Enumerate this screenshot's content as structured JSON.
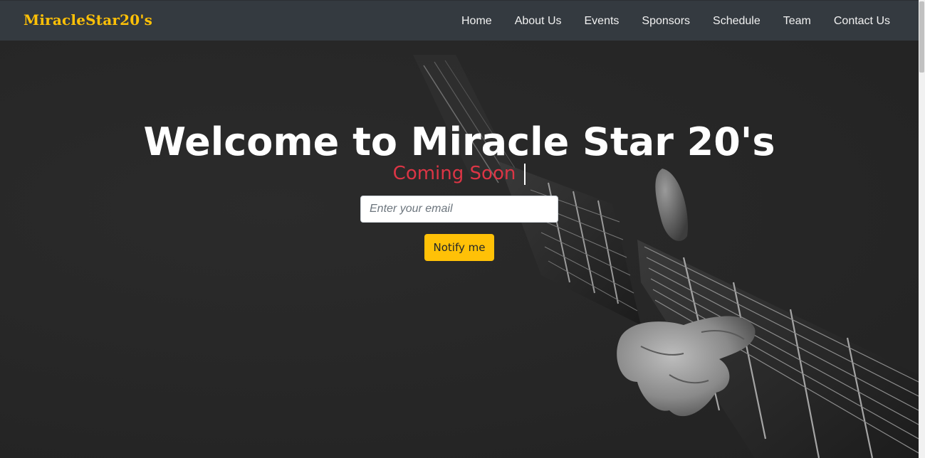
{
  "navbar": {
    "brand": "MiracleStar20's",
    "links": [
      {
        "label": "Home"
      },
      {
        "label": "About Us"
      },
      {
        "label": "Events"
      },
      {
        "label": "Sponsors"
      },
      {
        "label": "Schedule"
      },
      {
        "label": "Team"
      },
      {
        "label": "Contact Us"
      }
    ]
  },
  "hero": {
    "title": "Welcome to Miracle Star 20's",
    "subtitle": "Coming Soon",
    "email_placeholder": "Enter your email",
    "email_value": "",
    "notify_label": "Notify me",
    "background_image": "guitar-fretboard-hand"
  },
  "colors": {
    "accent": "#ffc107",
    "navbar_bg": "#343a40",
    "hero_bg": "#282828",
    "subtitle": "#dc3545",
    "text_light": "#ffffff"
  }
}
